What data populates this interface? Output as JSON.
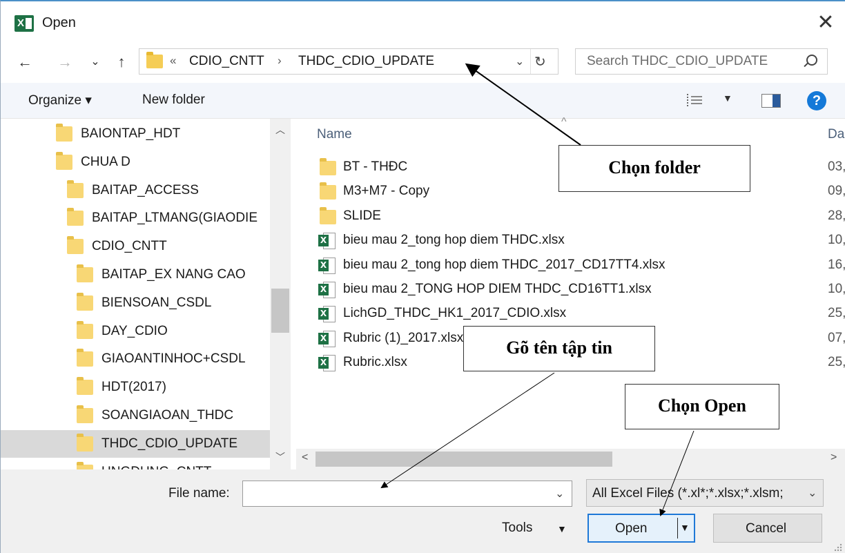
{
  "window": {
    "title": "Open",
    "app_icon_letter": "X",
    "close_glyph": "✕"
  },
  "nav": {
    "back_glyph": "←",
    "forward_glyph": "→",
    "recent_glyph": "⌄",
    "up_glyph": "↑"
  },
  "address": {
    "overflow": "«",
    "crumbs": [
      "CDIO_CNTT",
      "THDC_CDIO_UPDATE"
    ],
    "separator": "›",
    "refresh_glyph": "↻",
    "dropdown_glyph": "⌄"
  },
  "search": {
    "placeholder": "Search THDC_CDIO_UPDATE"
  },
  "toolbar": {
    "organize_label": "Organize ▾",
    "new_folder_label": "New folder",
    "view_dropdown": "▼",
    "help_label": "?"
  },
  "tree": {
    "items": [
      {
        "label": "BAIONTAP_HDT",
        "level": 0
      },
      {
        "label": "CHUA D",
        "level": 0
      },
      {
        "label": "BAITAP_ACCESS",
        "level": 1
      },
      {
        "label": "BAITAP_LTMANG(GIAODIE",
        "level": 1
      },
      {
        "label": "CDIO_CNTT",
        "level": 1
      },
      {
        "label": "BAITAP_EX NANG CAO",
        "level": 2
      },
      {
        "label": "BIENSOAN_CSDL",
        "level": 2
      },
      {
        "label": "DAY_CDIO",
        "level": 2
      },
      {
        "label": "GIAOANTINHOC+CSDL",
        "level": 2
      },
      {
        "label": "HDT(2017)",
        "level": 2
      },
      {
        "label": "SOANGIAOAN_THDC",
        "level": 2
      },
      {
        "label": "THDC_CDIO_UPDATE",
        "level": 2,
        "selected": true
      },
      {
        "label": "UNGDUNG_CNTT",
        "level": 2
      }
    ]
  },
  "list": {
    "col_name": "Name",
    "col_date": "Da",
    "sort_glyph": "^",
    "rows": [
      {
        "name": "BT - THĐC",
        "type": "folder",
        "date": "03,"
      },
      {
        "name": "M3+M7 - Copy",
        "type": "folder",
        "date": "09,"
      },
      {
        "name": "SLIDE",
        "type": "folder",
        "date": "28,"
      },
      {
        "name": "bieu mau 2_tong hop diem THDC.xlsx",
        "type": "xlsx",
        "date": "10,"
      },
      {
        "name": "bieu mau 2_tong hop diem THDC_2017_CD17TT4.xlsx",
        "type": "xlsx",
        "date": "16,"
      },
      {
        "name": "bieu mau 2_TONG HOP DIEM THDC_CD16TT1.xlsx",
        "type": "xlsx",
        "date": "10,"
      },
      {
        "name": "LichGD_THDC_HK1_2017_CDIO.xlsx",
        "type": "xlsx",
        "date": "25,"
      },
      {
        "name": "Rubric (1)_2017.xlsx",
        "type": "xlsx",
        "date": "07,"
      },
      {
        "name": "Rubric.xlsx",
        "type": "xlsx",
        "date": "25,"
      }
    ]
  },
  "bottom": {
    "file_name_label": "File name:",
    "file_name_value": "",
    "file_type_value": "All Excel Files (*.xl*;*.xlsx;*.xlsm;",
    "tools_label": "Tools",
    "open_label": "Open",
    "cancel_label": "Cancel"
  },
  "annotations": {
    "choose_folder": "Chọn folder",
    "type_filename": "Gõ tên tập tin",
    "choose_open": "Chọn Open"
  },
  "colors": {
    "accent": "#1e78d7",
    "excel_green": "#1e7145",
    "folder_yellow": "#f8d775",
    "selected_row": "#d9d9d9"
  }
}
